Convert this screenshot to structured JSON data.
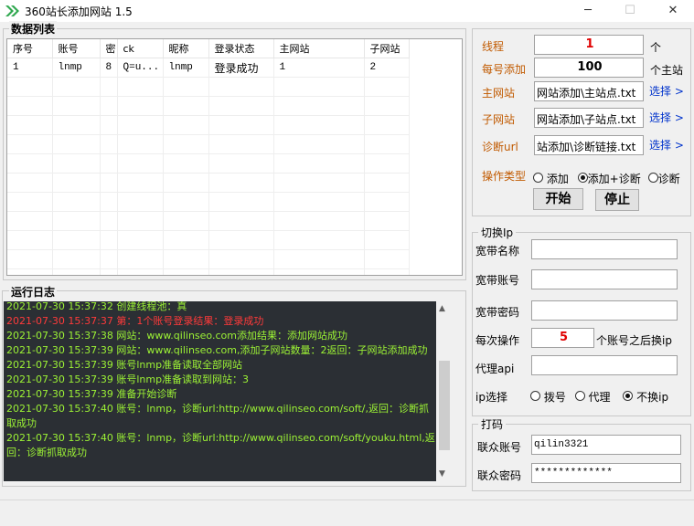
{
  "window": {
    "title": "360站长添加网站 1.5",
    "minimize": "─",
    "maximize": "☐",
    "close": "✕"
  },
  "data_list": {
    "title": "数据列表",
    "columns": [
      "序号",
      "账号",
      "密",
      "ck",
      "昵称",
      "登录状态",
      "主网站",
      "子网站"
    ],
    "rows": [
      [
        "1",
        "lnmp",
        "8",
        "Q=u...",
        "lnmp",
        "登录成功",
        "1",
        "2"
      ]
    ]
  },
  "log": {
    "title": "运行日志",
    "lines": [
      {
        "text": "2021-07-30 15:37:32 创建线程池：真",
        "color": "green"
      },
      {
        "text": "2021-07-30 15:37:37 第：1个账号登录结果：登录成功",
        "color": "red"
      },
      {
        "text": "2021-07-30 15:37:38 网站：www.qilinseo.com添加结果：添加网站成功",
        "color": "green"
      },
      {
        "text": "2021-07-30 15:37:39 网站：www.qilinseo.com,添加子网站数量：2返回：子网站添加成功",
        "color": "green"
      },
      {
        "text": "2021-07-30 15:37:39 账号lnmp准备读取全部网站",
        "color": "green"
      },
      {
        "text": "2021-07-30 15:37:39 账号lnmp准备读取到网站：3",
        "color": "green"
      },
      {
        "text": "2021-07-30 15:37:39 准备开始诊断",
        "color": "green"
      },
      {
        "text": "2021-07-30 15:37:40 账号：lnmp，诊断url:http://www.qilinseo.com/soft/,返回：诊断抓取成功",
        "color": "green"
      },
      {
        "text": "2021-07-30 15:37:40 账号：lnmp，诊断url:http://www.qilinseo.com/soft/youku.html,返回：诊断抓取成功",
        "color": "green"
      }
    ]
  },
  "settings": {
    "threads_label": "线程",
    "threads_value": "1",
    "threads_unit": "个",
    "per_account_label": "每号添加",
    "per_account_value": "100",
    "per_account_unit": "个主站",
    "main_site_label": "主网站",
    "main_site_value": "网站添加\\主站点.txt",
    "main_site_select": "选择 >",
    "sub_site_label": "子网站",
    "sub_site_value": "网站添加\\子站点.txt",
    "sub_site_select": "选择 >",
    "diag_label": "诊断url",
    "diag_value": "站添加\\诊断链接.txt",
    "diag_select": "选择 >",
    "op_type_label": "操作类型",
    "op_options": [
      {
        "label": "添加",
        "checked": false
      },
      {
        "label": "添加+诊断",
        "checked": true
      },
      {
        "label": "诊断",
        "checked": false
      }
    ],
    "start_button": "开始",
    "stop_button": "停止"
  },
  "switch_ip": {
    "title": "切换Ip",
    "broadband_name_label": "宽带名称",
    "broadband_name_value": "",
    "broadband_account_label": "宽带账号",
    "broadband_account_value": "",
    "broadband_password_label": "宽带密码",
    "broadband_password_value": "",
    "per_op_label": "每次操作",
    "per_op_value": "5",
    "per_op_suffix": "个账号之后换ip",
    "proxy_api_label": "代理api",
    "proxy_api_value": "",
    "ip_select_label": "ip选择",
    "ip_options": [
      {
        "label": "拨号",
        "checked": false
      },
      {
        "label": "代理",
        "checked": false
      },
      {
        "label": "不换ip",
        "checked": true
      }
    ]
  },
  "captcha": {
    "title": "打码",
    "account_label": "联众账号",
    "account_value": "qilin3321",
    "password_label": "联众密码",
    "password_value": "*************"
  },
  "colors": {
    "log_bg": "#2b2f34",
    "log_green": "#9cf235",
    "log_red": "#ff3a3a",
    "label_brown": "#c15a00",
    "link_blue": "#0033cc",
    "number_red": "#e00000"
  }
}
